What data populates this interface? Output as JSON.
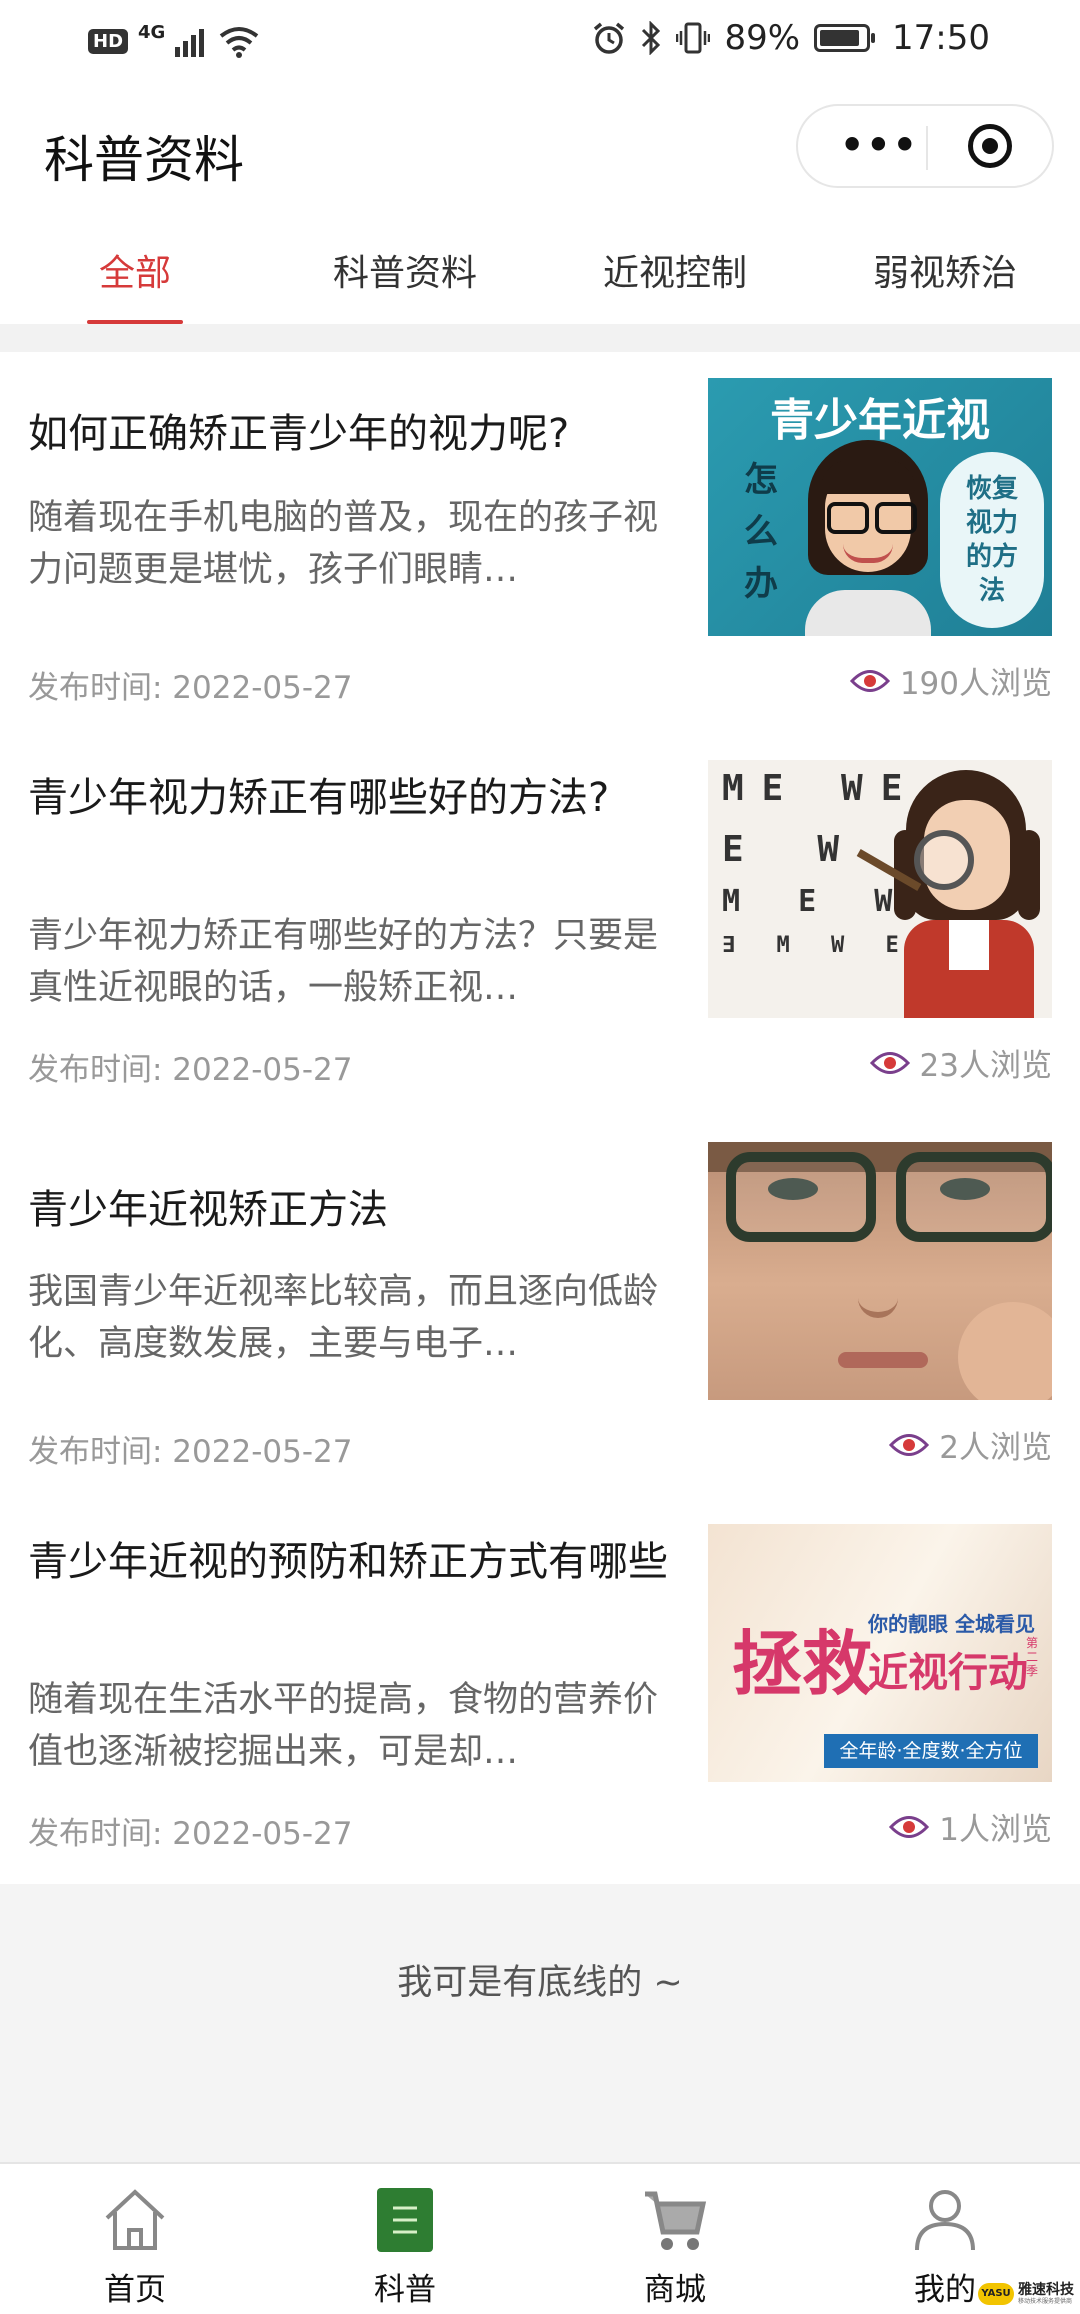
{
  "status_bar": {
    "hd": "HD",
    "network": "4G",
    "battery": "89%",
    "battery_level": 0.89,
    "time": "17:50"
  },
  "nav": {
    "title": "科普资料",
    "more_icon": "more-dots-icon",
    "close_icon": "target-circle-icon"
  },
  "tabs": [
    {
      "label": "全部",
      "active": true
    },
    {
      "label": "科普资料",
      "active": false
    },
    {
      "label": "近视控制",
      "active": false
    },
    {
      "label": "弱视矫治",
      "active": false
    }
  ],
  "articles": [
    {
      "title": "如何正确矫正青少年的视力呢?",
      "summary": "随着现在手机电脑的普及，现在的孩子视力问题更是堪忧，孩子们眼睛…",
      "date": "发布时间: 2022-05-27",
      "views": "190人浏览",
      "thumb": {
        "heading": "青少年近视",
        "side_left": "怎么办",
        "side_right": "恢复视力的方法"
      }
    },
    {
      "title": "青少年视力矫正有哪些好的方法?",
      "summary": "青少年视力矫正有哪些好的方法？只要是真性近视眼的话，一般矫正视…",
      "date": "发布时间: 2022-05-27",
      "views": "23人浏览",
      "thumb": {
        "chart_rows": [
          "ME WE",
          "E W ∃",
          "M E W",
          "∃ M W E"
        ]
      }
    },
    {
      "title": "青少年近视矫正方法",
      "summary": "我国青少年近视率比较高，而且逐向低龄化、高度数发展，主要与电子…",
      "date": "发布时间: 2022-05-27",
      "views": "2人浏览",
      "thumb": {}
    },
    {
      "title": "青少年近视的预防和矫正方式有哪些",
      "summary": "随着现在生活水平的提高，食物的营养价值也逐渐被挖掘出来，可是却…",
      "date": "发布时间: 2022-05-27",
      "views": "1人浏览",
      "thumb": {
        "big": "拯救",
        "tag1": "你的靓眼 全城看见",
        "big2": "近视行动",
        "season": "第二季",
        "banner": "全年龄·全度数·全方位"
      }
    }
  ],
  "footer_tip": "我可是有底线的 ~",
  "tab_bar": [
    {
      "label": "首页",
      "icon": "home-icon"
    },
    {
      "label": "科普",
      "icon": "document-icon"
    },
    {
      "label": "商城",
      "icon": "cart-icon"
    },
    {
      "label": "我的",
      "icon": "user-icon"
    }
  ],
  "brand": {
    "logo": "YASU",
    "name": "雅速科技",
    "slogan": "移动技术服务提供商"
  },
  "colors": {
    "accent": "#d63a3a",
    "tab_active_icon": "#2e7d32",
    "eye": "#7a3f8c"
  }
}
